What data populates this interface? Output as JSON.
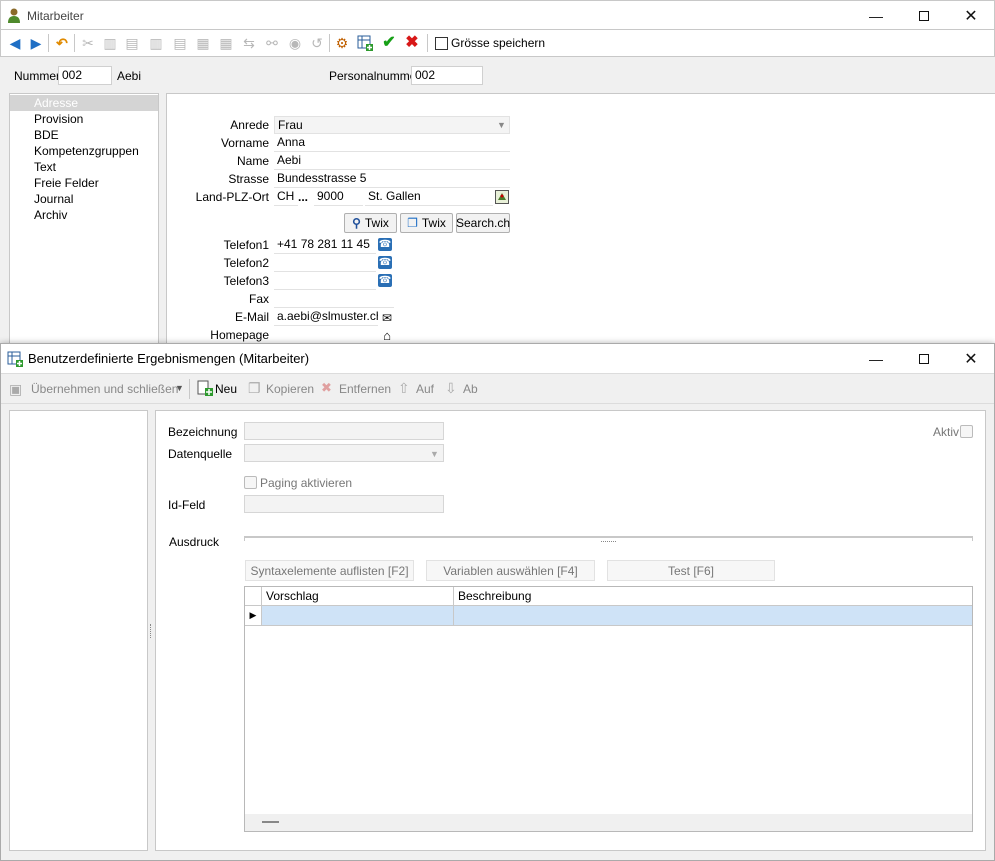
{
  "main_window": {
    "title": "Mitarbeiter",
    "toolbar": {
      "groesse_label": "Grösse speichern"
    },
    "header": {
      "nummer_label": "Nummer",
      "nummer_value": "002",
      "name_value": "Aebi",
      "personalnummer_label": "Personalnummer",
      "personalnummer_value": "002"
    },
    "nav": [
      "Adresse",
      "Provision",
      "BDE",
      "Kompetenzgruppen",
      "Text",
      "Freie Felder",
      "Journal",
      "Archiv"
    ],
    "form": {
      "anrede_label": "Anrede",
      "anrede_value": "Frau",
      "vorname_label": "Vorname",
      "vorname_value": "Anna",
      "name_label": "Name",
      "name_value": "Aebi",
      "strasse_label": "Strasse",
      "strasse_value": "Bundesstrasse 5",
      "landplz_label": "Land-PLZ-Ort",
      "land_value": "CH",
      "dots": "...",
      "plz_value": "9000",
      "ort_value": "St. Gallen",
      "btn_twix1": "Twix",
      "btn_twix2": "Twix",
      "btn_search": "Search.ch",
      "telefon1_label": "Telefon1",
      "telefon1_value": "+41 78 281 11 45",
      "telefon2_label": "Telefon2",
      "telefon2_value": "",
      "telefon3_label": "Telefon3",
      "telefon3_value": "",
      "fax_label": "Fax",
      "fax_value": "",
      "email_label": "E-Mail",
      "email_value": "a.aebi@slmuster.ch",
      "homepage_label": "Homepage",
      "homepage_value": ""
    }
  },
  "dialog": {
    "title": "Benutzerdefinierte Ergebnismengen (Mitarbeiter)",
    "toolbar": {
      "uebernehmen": "Übernehmen und schließen",
      "neu": "Neu",
      "kopieren": "Kopieren",
      "entfernen": "Entfernen",
      "auf": "Auf",
      "ab": "Ab"
    },
    "form": {
      "bezeichnung_label": "Bezeichnung",
      "datenquelle_label": "Datenquelle",
      "paging_label": "Paging aktivieren",
      "idfeld_label": "Id-Feld",
      "ausdruck_label": "Ausdruck",
      "aktiv_label": "Aktiv",
      "btn_syntax": "Syntaxelemente auflisten [F2]",
      "btn_variablen": "Variablen auswählen [F4]",
      "btn_test": "Test [F6]"
    },
    "grid": {
      "col_vorschlag": "Vorschlag",
      "col_beschreibung": "Beschreibung"
    }
  },
  "colors": {
    "selection": "#cfe3f7",
    "nav_selected": "#d4d4d4",
    "accent_blue": "#1f6fc5"
  }
}
